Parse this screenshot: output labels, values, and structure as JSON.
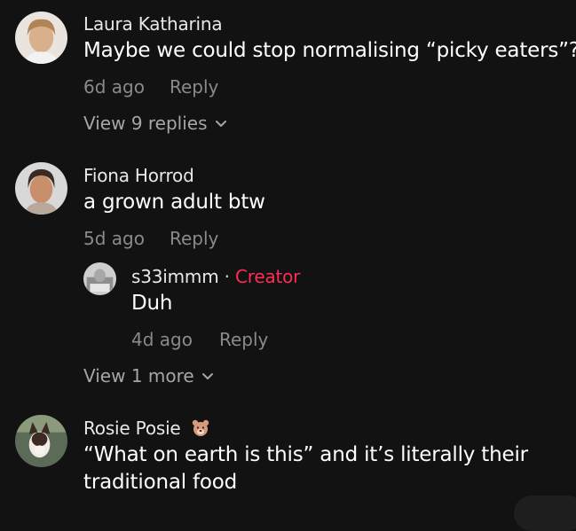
{
  "comments": [
    {
      "author": "Laura Katharina",
      "text": "Maybe we could stop normalising “picky eaters”?",
      "time": "6d ago",
      "reply_label": "Reply",
      "view_replies": "View 9 replies"
    },
    {
      "author": "Fiona Horrod",
      "text": "a grown adult btw",
      "time": "5d ago",
      "reply_label": "Reply",
      "reply": {
        "author": "s33immm",
        "separator": "·",
        "badge": "Creator",
        "text": "Duh",
        "time": "4d ago",
        "reply_label": "Reply"
      },
      "view_more": "View 1 more"
    },
    {
      "author": "Rosie Posie",
      "author_emoji_icon": "bear-face-icon",
      "text_line1": "“What on earth is this” and it’s literally their",
      "text_line2": "traditional food"
    }
  ],
  "colors": {
    "background": "#121212",
    "creator_accent": "#fe2c55",
    "muted_text": "#8a8a8a"
  }
}
